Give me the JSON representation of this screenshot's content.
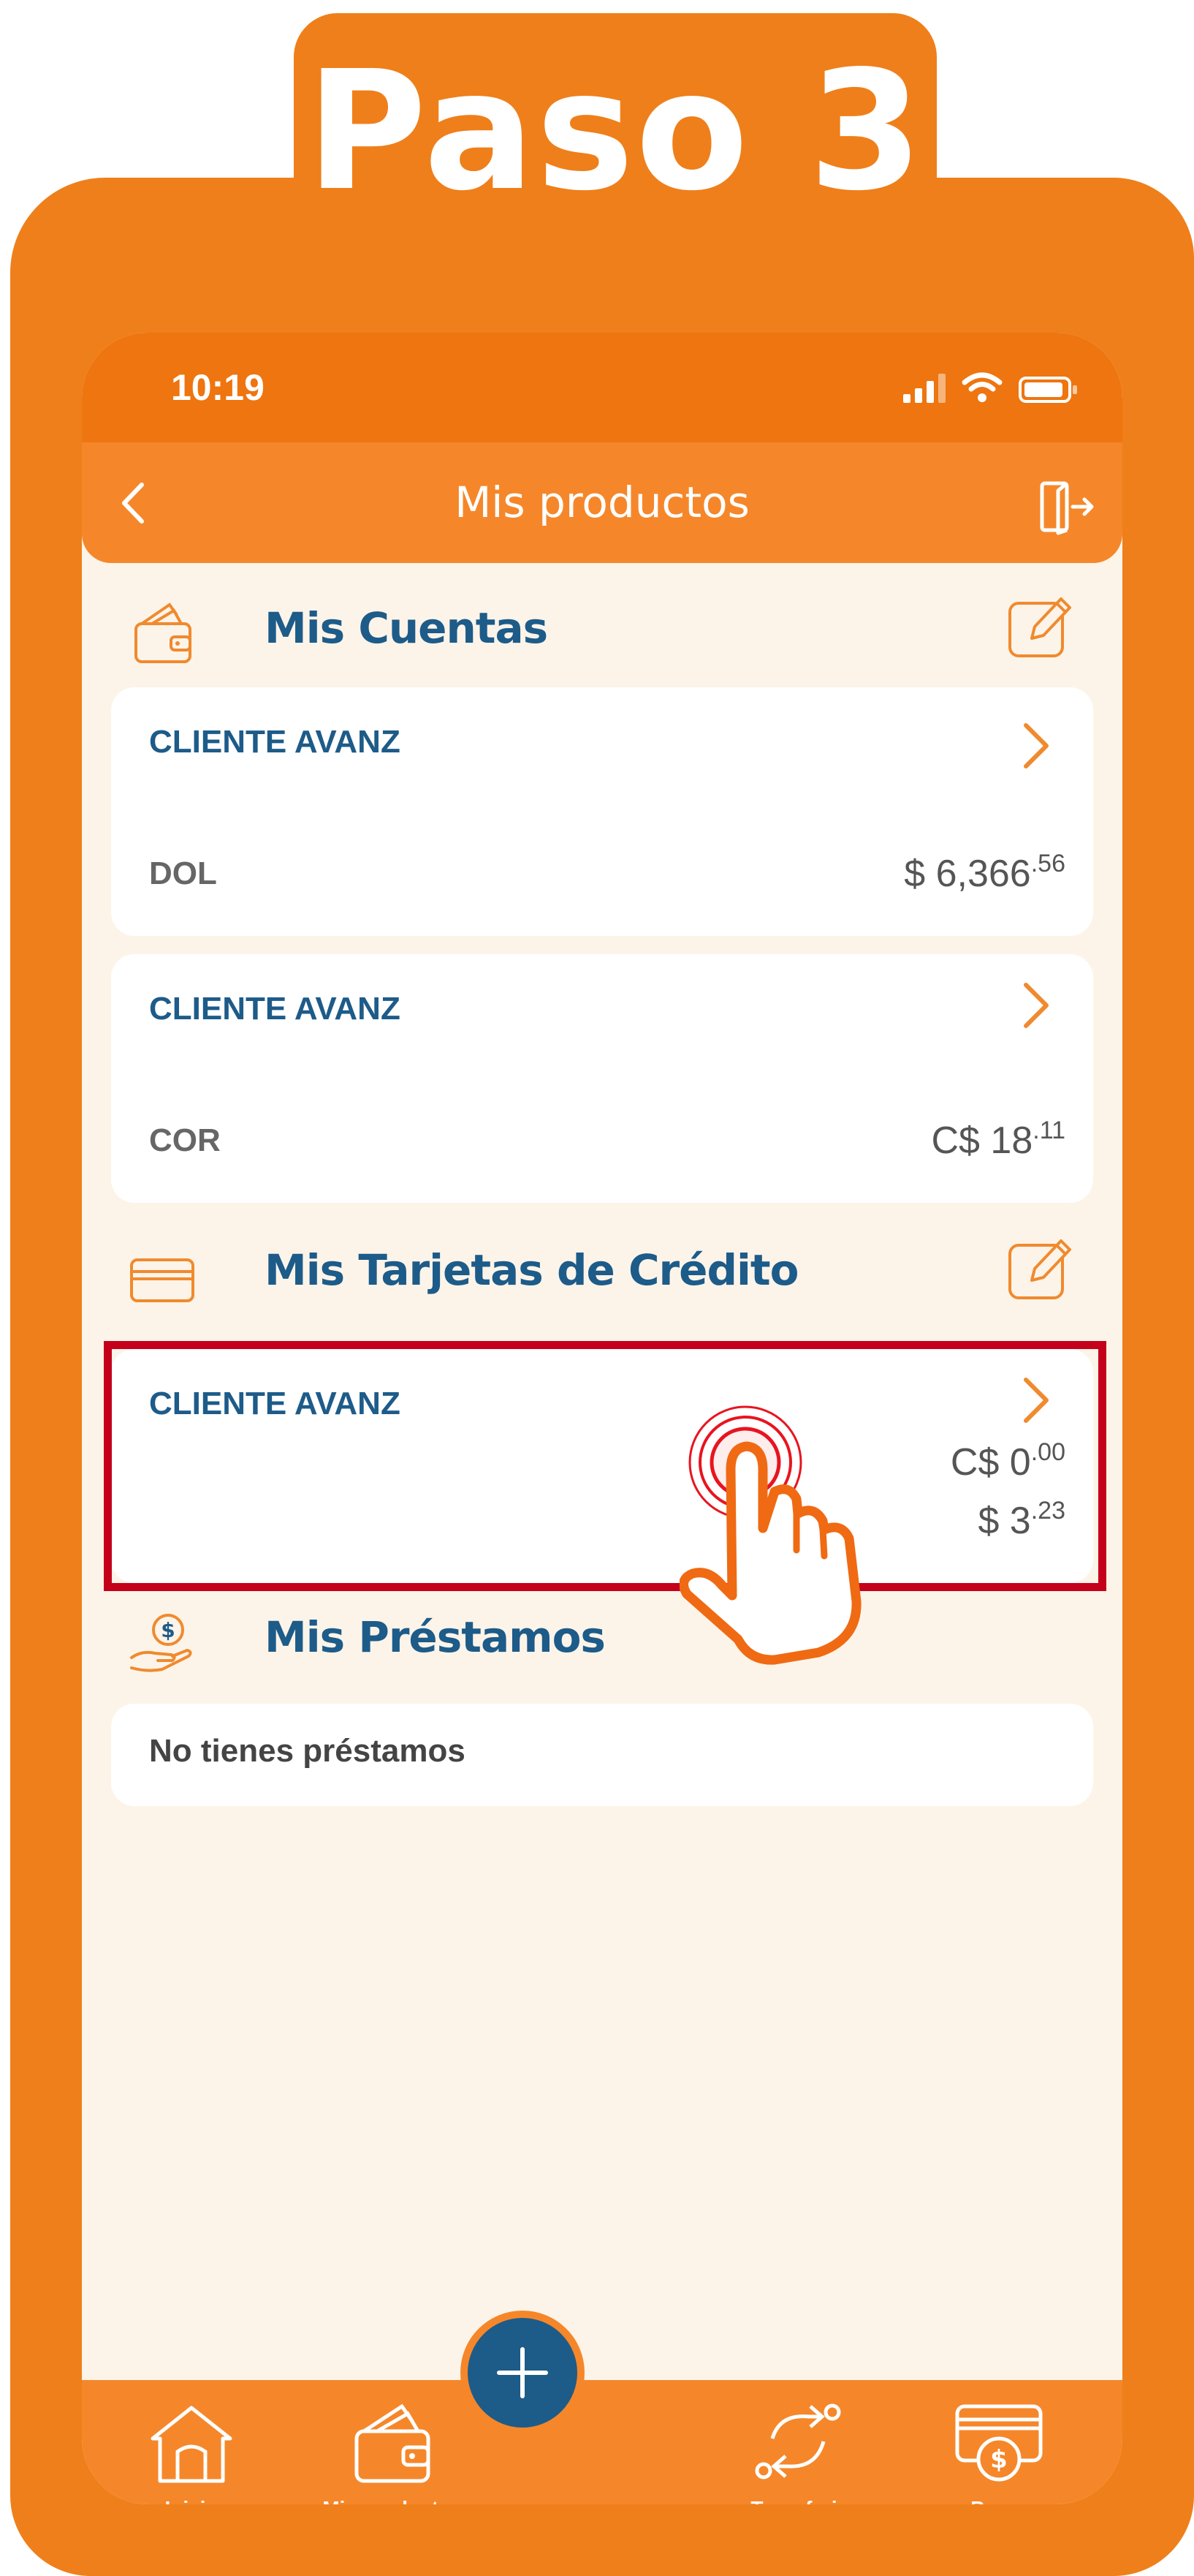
{
  "step": {
    "title": "Paso 3"
  },
  "status_bar": {
    "time": "10:19"
  },
  "header": {
    "title": "Mis productos"
  },
  "sections": {
    "accounts": {
      "title": "Mis Cuentas",
      "items": [
        {
          "name": "CLIENTE AVANZ",
          "currency": "DOL",
          "amount_main": "$ 6,366",
          "amount_cents": ".56"
        },
        {
          "name": "CLIENTE AVANZ",
          "currency": "COR",
          "amount_main": "C$ 18",
          "amount_cents": ".11"
        }
      ]
    },
    "credit_cards": {
      "title": "Mis Tarjetas de Crédito",
      "items": [
        {
          "name": "CLIENTE AVANZ",
          "amount1_main": "C$ 0",
          "amount1_cents": ".00",
          "amount2_main": "$ 3",
          "amount2_cents": ".23"
        }
      ]
    },
    "loans": {
      "title": "Mis Préstamos",
      "empty_text": "No tienes préstamos"
    }
  },
  "bottom_nav": {
    "items": [
      {
        "label": "Inicio",
        "icon": "home-icon"
      },
      {
        "label": "Mis productos",
        "icon": "wallet-icon"
      },
      {
        "label": "Transferir",
        "icon": "transfer-icon"
      },
      {
        "label": "Pagar",
        "icon": "pay-icon"
      }
    ],
    "fab_icon": "plus-icon"
  },
  "colors": {
    "brand_orange": "#ef7f1a",
    "nav_orange": "#f5872a",
    "primary_blue": "#1d5b89",
    "highlight_red": "#c4001a",
    "background": "#fcf4e9"
  }
}
